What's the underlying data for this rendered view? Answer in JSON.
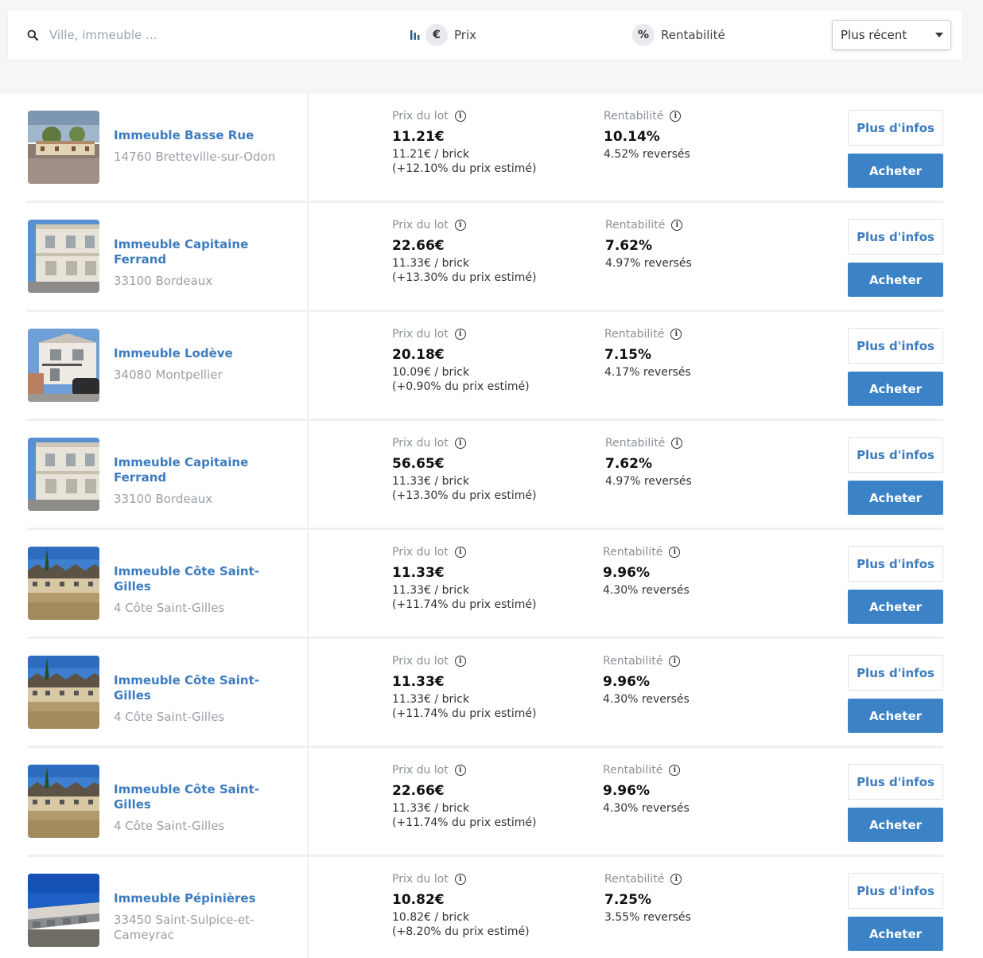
{
  "filters": {
    "search_placeholder": "Ville, immeuble ...",
    "prix_label": "Prix",
    "prix_icon": "€",
    "rent_label": "Rentabilité",
    "rent_icon": "%",
    "sort_selected": "Plus récent"
  },
  "labels": {
    "prix_du_lot": "Prix du lot",
    "rentabilite": "Rentabilité",
    "info_icon": "i",
    "plus_infos": "Plus d'infos",
    "acheter": "Acheter"
  },
  "colors": {
    "accent": "#3b82c6",
    "title": "#3d7cbf"
  },
  "properties": [
    {
      "title": "Immeuble Basse Rue",
      "address": "14760 Bretteville-sur-Odon",
      "price": "11.21€",
      "per_brick": "11.21€ / brick",
      "estimate": "(+12.10% du prix estimé)",
      "yield": "10.14%",
      "paid": "4.52% reversés",
      "image": "house-beige"
    },
    {
      "title": "Immeuble Capitaine Ferrand",
      "address": "33100 Bordeaux",
      "price": "22.66€",
      "per_brick": "11.33€ / brick",
      "estimate": "(+13.30% du prix estimé)",
      "yield": "7.62%",
      "paid": "4.97% reversés",
      "image": "facade-white"
    },
    {
      "title": "Immeuble Lodève",
      "address": "34080 Montpellier",
      "price": "20.18€",
      "per_brick": "10.09€ / brick",
      "estimate": "(+0.90% du prix estimé)",
      "yield": "7.15%",
      "paid": "4.17% reversés",
      "image": "villa-balcony"
    },
    {
      "title": "Immeuble Capitaine Ferrand",
      "address": "33100 Bordeaux",
      "price": "56.65€",
      "per_brick": "11.33€ / brick",
      "estimate": "(+13.30% du prix estimé)",
      "yield": "7.62%",
      "paid": "4.97% reversés",
      "image": "facade-white"
    },
    {
      "title": "Immeuble Côte Saint-Gilles",
      "address": "4 Côte Saint-Gilles",
      "price": "11.33€",
      "per_brick": "11.33€ / brick",
      "estimate": "(+11.74% du prix estimé)",
      "yield": "9.96%",
      "paid": "4.30% reversés",
      "image": "row-houses"
    },
    {
      "title": "Immeuble Côte Saint-Gilles",
      "address": "4 Côte Saint-Gilles",
      "price": "11.33€",
      "per_brick": "11.33€ / brick",
      "estimate": "(+11.74% du prix estimé)",
      "yield": "9.96%",
      "paid": "4.30% reversés",
      "image": "row-houses"
    },
    {
      "title": "Immeuble Côte Saint-Gilles",
      "address": "4 Côte Saint-Gilles",
      "price": "22.66€",
      "per_brick": "11.33€ / brick",
      "estimate": "(+11.74% du prix estimé)",
      "yield": "9.96%",
      "paid": "4.30% reversés",
      "image": "row-houses"
    },
    {
      "title": "Immeuble Pépinières",
      "address": "33450 Saint-Sulpice-et-Cameyrac",
      "price": "10.82€",
      "per_brick": "10.82€ / brick",
      "estimate": "(+8.20% du prix estimé)",
      "yield": "7.25%",
      "paid": "3.55% reversés",
      "image": "garages"
    }
  ]
}
